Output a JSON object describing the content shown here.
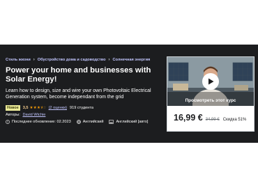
{
  "breadcrumb": [
    "Стиль жизни",
    "Обустройство дома и садоводство",
    "Солнечная энергия"
  ],
  "course": {
    "title": "Power your home and businesses with Solar Energy!",
    "subtitle": "Learn how to design, size and wire your own Photovoltaic Electrical Generation system, become independant from the grid",
    "badge": "Новое",
    "rating_value": "3,5",
    "rating_stars": 3.5,
    "reviews_link": "(2 оценки)",
    "students": "919 студента",
    "author_label": "Авторы:",
    "author_name": "David Wtchie",
    "last_updated": "Последнее обновление: 02.2023",
    "language": "Английский",
    "captions": "Английский [авто]"
  },
  "card": {
    "preview_caption": "Просмотреть этот курс",
    "price": "16,99 €",
    "old_price": "34,99 €",
    "discount": "Скидка 51%"
  },
  "colors": {
    "hero_bg": "#1c1d1f",
    "link": "#c0c4fc",
    "star": "#f69c08",
    "badge_bg": "#eceb98"
  },
  "icons": [
    "globe-icon",
    "captions-icon",
    "alert-icon",
    "play-icon"
  ]
}
